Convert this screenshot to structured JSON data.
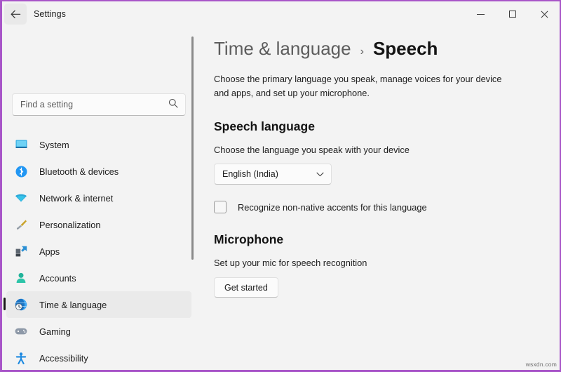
{
  "window": {
    "app_title": "Settings",
    "back_icon": "back-arrow-icon",
    "minimize_label": "–",
    "maximize_label": "□",
    "close_label": "✕",
    "border_color": "#a855c8",
    "background": "#f3f3f3"
  },
  "sidebar": {
    "search": {
      "placeholder": "Find a setting",
      "value": "",
      "icon": "search-icon"
    },
    "items": [
      {
        "label": "System",
        "icon": "monitor-icon",
        "selected": false
      },
      {
        "label": "Bluetooth & devices",
        "icon": "bluetooth-icon",
        "selected": false
      },
      {
        "label": "Network & internet",
        "icon": "wifi-icon",
        "selected": false
      },
      {
        "label": "Personalization",
        "icon": "paintbrush-icon",
        "selected": false
      },
      {
        "label": "Apps",
        "icon": "apps-icon",
        "selected": false
      },
      {
        "label": "Accounts",
        "icon": "person-icon",
        "selected": false
      },
      {
        "label": "Time & language",
        "icon": "globe-clock-icon",
        "selected": true
      },
      {
        "label": "Gaming",
        "icon": "gamepad-icon",
        "selected": false
      },
      {
        "label": "Accessibility",
        "icon": "accessibility-icon",
        "selected": false
      }
    ],
    "selected_accent": "#1a1a1a",
    "selected_background": "#eaeaea"
  },
  "main": {
    "breadcrumb": {
      "parent": "Time & language",
      "separator": "›",
      "current": "Speech"
    },
    "description": "Choose the primary language you speak, manage voices for your device and apps, and set up your microphone.",
    "speech_language": {
      "heading": "Speech language",
      "subtitle": "Choose the language you speak with your device",
      "dropdown_value": "English (India)",
      "dropdown_icon": "chevron-down-icon",
      "checkbox_label": "Recognize non-native accents for this language",
      "checkbox_checked": false
    },
    "microphone": {
      "heading": "Microphone",
      "subtitle": "Set up your mic for speech recognition",
      "button_label": "Get started"
    }
  },
  "watermark": "wsxdn.com"
}
